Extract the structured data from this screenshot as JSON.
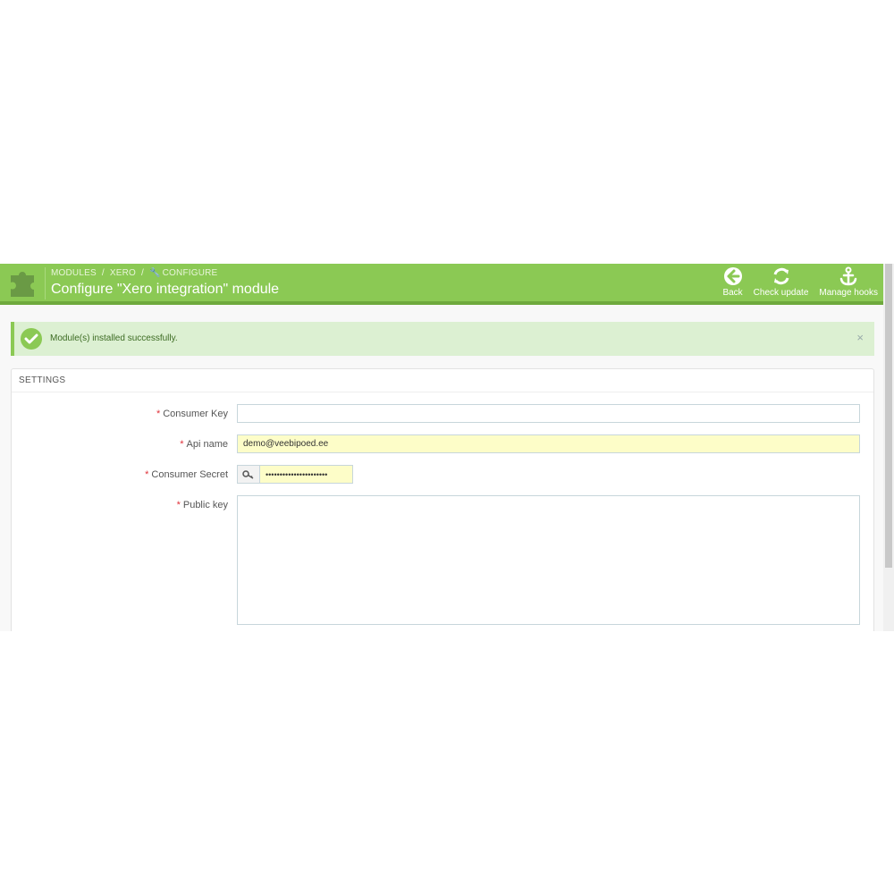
{
  "breadcrumb": [
    "MODULES",
    "XERO",
    "CONFIGURE"
  ],
  "page_title": "Configure \"Xero integration\" module",
  "toolbar": [
    {
      "label": "Back",
      "icon": "arrow-left-circle-icon"
    },
    {
      "label": "Check update",
      "icon": "refresh-icon"
    },
    {
      "label": "Manage hooks",
      "icon": "anchor-icon"
    }
  ],
  "alert": {
    "message": "Module(s) installed successfully.",
    "close": "×"
  },
  "panel": {
    "heading": "SETTINGS"
  },
  "form": {
    "consumer_key": {
      "label": "Consumer Key",
      "value": ""
    },
    "api_name": {
      "label": "Api name",
      "value": "demo@veebipoed.ee"
    },
    "consumer_secret": {
      "label": "Consumer Secret",
      "value": "••••••••••••••••••••••"
    },
    "public_key": {
      "label": "Public key",
      "value": ""
    }
  },
  "colors": {
    "header": "#8bc954",
    "alert_bg": "#dcf0d2",
    "required": "#e0323a",
    "autofill": "#fdfdc8"
  }
}
